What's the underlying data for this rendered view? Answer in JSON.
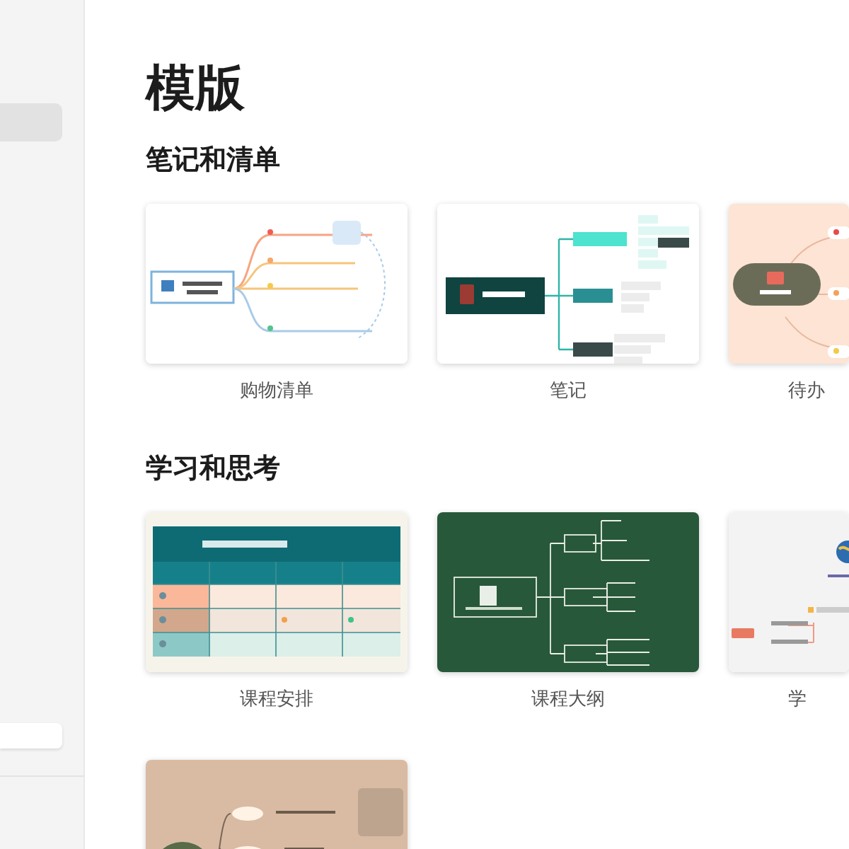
{
  "sidebar": {
    "items": [
      {
        "selected": true
      }
    ]
  },
  "page_title": "模版",
  "sections": [
    {
      "title": "笔记和清单",
      "templates": [
        {
          "kind": "grocery",
          "name": "购物清单"
        },
        {
          "kind": "notes",
          "name": "笔记"
        },
        {
          "kind": "todo",
          "name": "待办"
        }
      ]
    },
    {
      "title": "学习和思考",
      "templates": [
        {
          "kind": "schedule",
          "name": "课程安排"
        },
        {
          "kind": "syllabus",
          "name": "课程大纲"
        },
        {
          "kind": "thesis",
          "name": "学"
        },
        {
          "kind": "ladybug"
        }
      ]
    }
  ]
}
